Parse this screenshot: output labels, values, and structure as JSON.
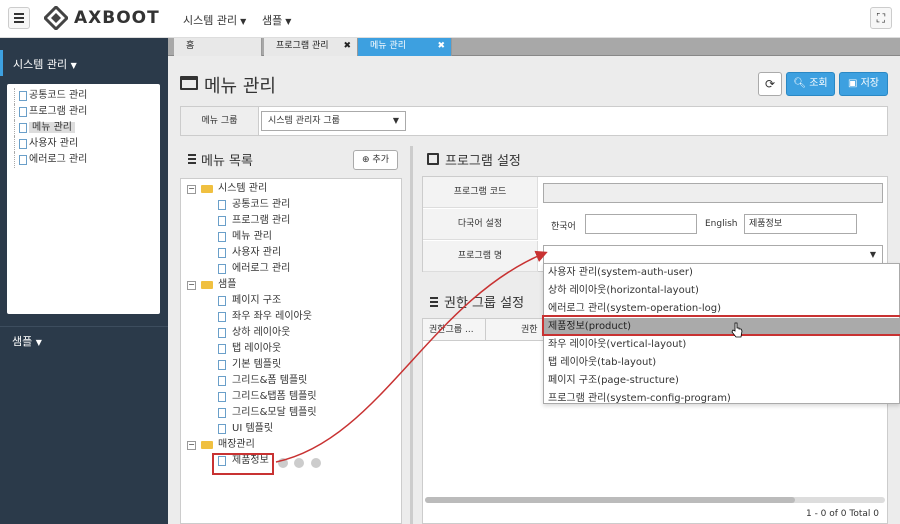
{
  "header": {
    "logo_text": "AXBOOT",
    "menus": [
      {
        "label": "시스템 관리"
      },
      {
        "label": "샘플"
      }
    ]
  },
  "sidebar": {
    "section1": "시스템 관리",
    "items": [
      {
        "label": "공통코드 관리"
      },
      {
        "label": "프로그램 관리"
      },
      {
        "label": "메뉴 관리"
      },
      {
        "label": "사용자 관리"
      },
      {
        "label": "에러로그 관리"
      }
    ],
    "section2": "샘플"
  },
  "tabs": [
    {
      "label": "홈"
    },
    {
      "label": "프로그램 관리"
    },
    {
      "label": "메뉴 관리"
    }
  ],
  "page": {
    "title": "메뉴 관리",
    "search_label": "조회",
    "save_label": "저장"
  },
  "filter": {
    "label": "메뉴 그룹",
    "value": "시스템 관리자 그룹"
  },
  "menu_list": {
    "title": "메뉴 목록",
    "add_label": "추가",
    "tree": [
      {
        "label": "시스템 관리",
        "children": [
          "공통코드 관리",
          "프로그램 관리",
          "메뉴 관리",
          "사용자 관리",
          "에러로그 관리"
        ]
      },
      {
        "label": "샘플",
        "children": [
          "페이지 구조",
          "좌우 좌우 레이아웃",
          "상하 레이아웃",
          "탭 레이아웃",
          "기본 템플릿",
          "그리드&폼 템플릿",
          "그리드&탭폼 템플릿",
          "그리드&모달 템플릿",
          "UI 템플릿"
        ]
      },
      {
        "label": "매장관리",
        "children": [
          "제품정보"
        ]
      }
    ]
  },
  "program": {
    "title": "프로그램 설정",
    "code_label": "프로그램 코드",
    "lang_label": "다국어 설정",
    "korean_label": "한국어",
    "english_label": "English",
    "english_value": "제품정보",
    "name_label": "프로그램 명"
  },
  "auth": {
    "title": "권한 그룹 설정",
    "col1": "권한그룹 ...",
    "col2": "권한",
    "footer": "1 - 0 of 0   Total 0"
  },
  "dropdown": {
    "options": [
      {
        "label": "사용자 관리(system-auth-user)"
      },
      {
        "label": "상하 레이아웃(horizontal-layout)"
      },
      {
        "label": "에러로그 관리(system-operation-log)"
      },
      {
        "label": "제품정보(product)"
      },
      {
        "label": "좌우 레이아웃(vertical-layout)"
      },
      {
        "label": "탭 레이아웃(tab-layout)"
      },
      {
        "label": "페이지 구조(page-structure)"
      },
      {
        "label": "프로그램 관리(system-config-program)"
      }
    ],
    "highlighted": "제품정보(product)"
  },
  "colors": {
    "accent": "#3da0e0",
    "sidebar": "#2b3a4a",
    "highlight": "#c83232"
  }
}
